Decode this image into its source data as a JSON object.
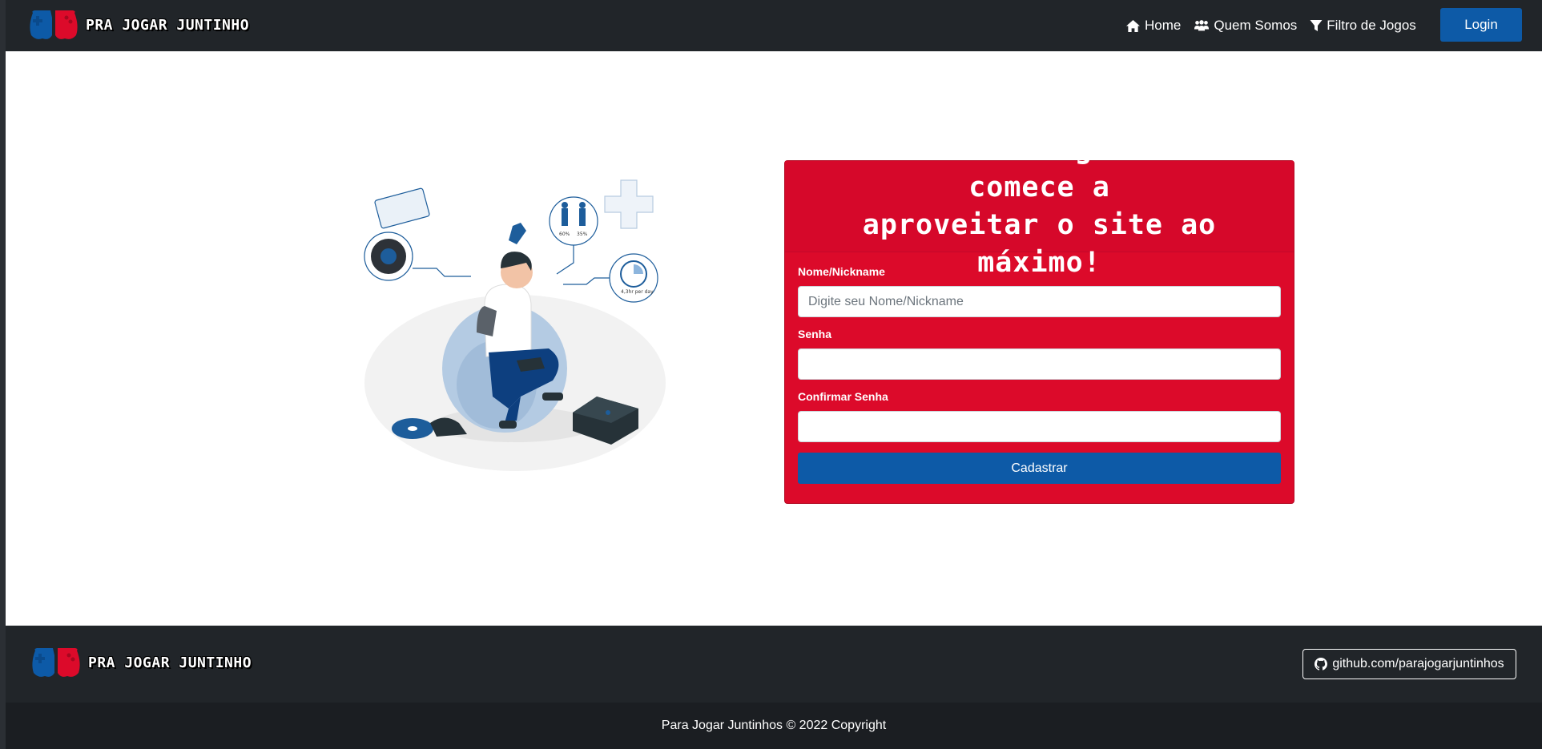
{
  "brand": {
    "name": "PRA JOGAR JUNTINHO",
    "logo_icon": "gamepad-logo-icon",
    "colors": {
      "red": "#dc0a2a",
      "blue": "#0d5aa7"
    }
  },
  "nav": {
    "items": [
      {
        "label": "Home",
        "icon": "home-icon"
      },
      {
        "label": "Quem Somos",
        "icon": "users-icon"
      },
      {
        "label": "Filtro de Jogos",
        "icon": "filter-icon"
      }
    ],
    "login_label": "Login"
  },
  "signup": {
    "title_line1": "Inscreva-se grátis e comece a",
    "title_line2": "aproveitar o site ao máximo!",
    "name_label": "Nome/Nickname",
    "name_placeholder": "Digite seu Nome/Nickname",
    "name_value": "",
    "password_label": "Senha",
    "password_value": "",
    "confirm_label": "Confirmar Senha",
    "confirm_value": "",
    "submit_label": "Cadastrar"
  },
  "illustration": {
    "icon": "gamer-illustration",
    "stat_labels": [
      "60%",
      "35%"
    ],
    "clock_label": "4,3hr per day"
  },
  "footer": {
    "brand_name": "PRA JOGAR JUNTINHO",
    "github_label": "github.com/parajogarjuntinhos",
    "github_icon": "github-icon",
    "copyright": "Para Jogar Juntinhos © 2022 Copyright"
  }
}
